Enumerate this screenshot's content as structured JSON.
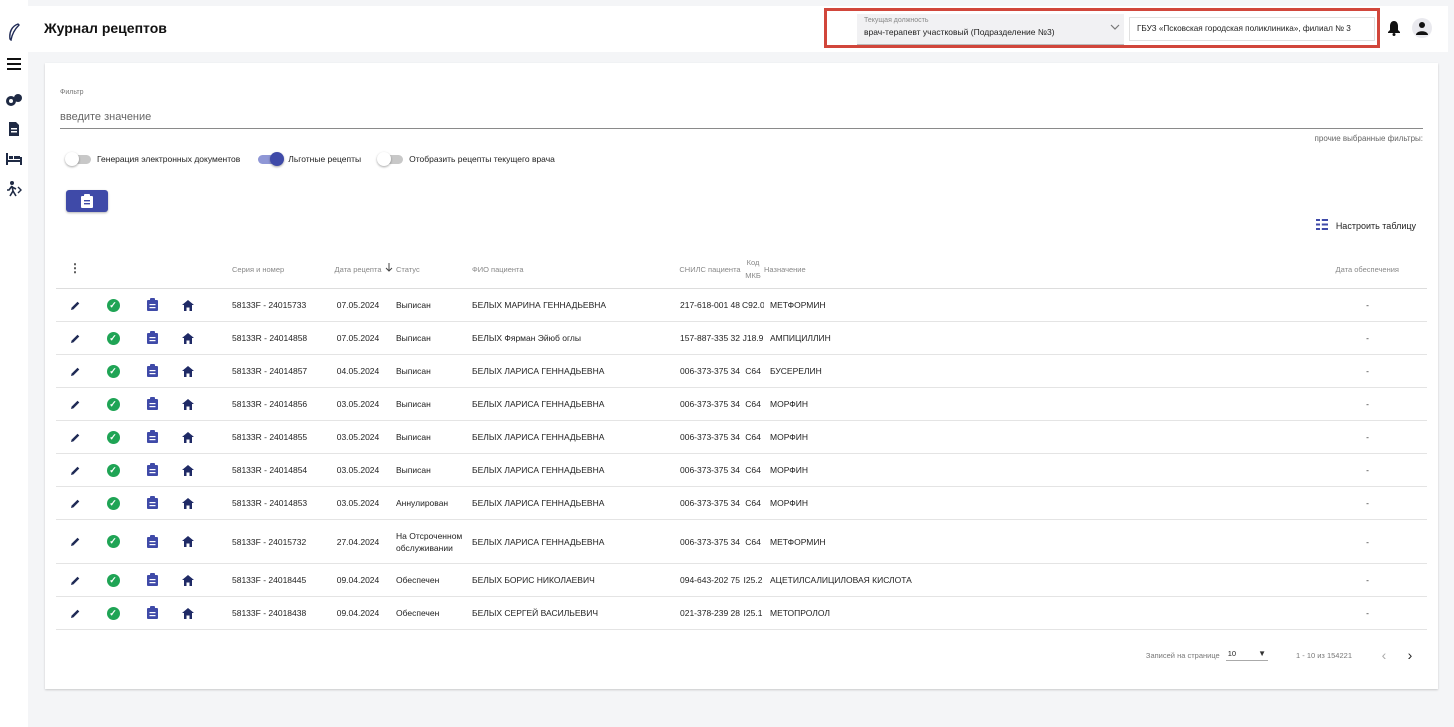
{
  "app": {
    "title": "Журнал рецептов"
  },
  "rail": {
    "icons": [
      "feather-logo-icon",
      "menu-icon",
      "pills-icon",
      "document-icon",
      "bed-icon",
      "walking-icon"
    ]
  },
  "header": {
    "position_label": "Текущая должность",
    "position_value": "врач-терапевт участковый (Подразделение №3)",
    "organization": "ГБУЗ «Псковская городская поликлиника», филиал № 3"
  },
  "filter": {
    "label": "Фильтр",
    "placeholder": "введите значение",
    "other_filters": "прочие выбранные фильтры:"
  },
  "toggles": [
    {
      "label": "Генерация электронных документов",
      "on": false
    },
    {
      "label": "Льготные рецепты",
      "on": true
    },
    {
      "label": "Отобразить рецепты текущего врача",
      "on": false
    }
  ],
  "config_table_label": "Настроить таблицу",
  "colors": {
    "primary": "#3f4aa8",
    "success": "#1fa455",
    "highlight": "#d1463b"
  },
  "table": {
    "headers": {
      "series": "Серия и номер",
      "date": "Дата рецепта",
      "status": "Статус",
      "patient": "ФИО пациента",
      "snils": "СНИЛС пациента",
      "mkb": "Код МКБ",
      "drug": "Назначение",
      "supply_date": "Дата обеспечения"
    },
    "rows": [
      {
        "series": "58133F - 24015733",
        "date": "07.05.2024",
        "status": "Выписан",
        "patient": "БЕЛЫХ МАРИНА ГЕННАДЬЕВНА",
        "snils": "217-618-001 48",
        "mkb": "C92.0",
        "drug": "МЕТФОРМИН",
        "supply": "-"
      },
      {
        "series": "58133R - 24014858",
        "date": "07.05.2024",
        "status": "Выписан",
        "patient": "БЕЛЫХ Фярман Эйюб оглы",
        "snils": "157-887-335 32",
        "mkb": "J18.9",
        "drug": "АМПИЦИЛЛИН",
        "supply": "-"
      },
      {
        "series": "58133R - 24014857",
        "date": "04.05.2024",
        "status": "Выписан",
        "patient": "БЕЛЫХ ЛАРИСА ГЕННАДЬЕВНА",
        "snils": "006-373-375 34",
        "mkb": "C64",
        "drug": "БУСЕРЕЛИН",
        "supply": "-"
      },
      {
        "series": "58133R - 24014856",
        "date": "03.05.2024",
        "status": "Выписан",
        "patient": "БЕЛЫХ ЛАРИСА ГЕННАДЬЕВНА",
        "snils": "006-373-375 34",
        "mkb": "C64",
        "drug": "МОРФИН",
        "supply": "-"
      },
      {
        "series": "58133R - 24014855",
        "date": "03.05.2024",
        "status": "Выписан",
        "patient": "БЕЛЫХ ЛАРИСА ГЕННАДЬЕВНА",
        "snils": "006-373-375 34",
        "mkb": "C64",
        "drug": "МОРФИН",
        "supply": "-"
      },
      {
        "series": "58133R - 24014854",
        "date": "03.05.2024",
        "status": "Выписан",
        "patient": "БЕЛЫХ ЛАРИСА ГЕННАДЬЕВНА",
        "snils": "006-373-375 34",
        "mkb": "C64",
        "drug": "МОРФИН",
        "supply": "-"
      },
      {
        "series": "58133R - 24014853",
        "date": "03.05.2024",
        "status": "Аннулирован",
        "patient": "БЕЛЫХ ЛАРИСА ГЕННАДЬЕВНА",
        "snils": "006-373-375 34",
        "mkb": "C64",
        "drug": "МОРФИН",
        "supply": "-"
      },
      {
        "series": "58133F - 24015732",
        "date": "27.04.2024",
        "status": "На Отсроченном обслуживании",
        "patient": "БЕЛЫХ ЛАРИСА ГЕННАДЬЕВНА",
        "snils": "006-373-375 34",
        "mkb": "C64",
        "drug": "МЕТФОРМИН",
        "supply": "-"
      },
      {
        "series": "58133F - 24018445",
        "date": "09.04.2024",
        "status": "Обеспечен",
        "patient": "БЕЛЫХ БОРИС НИКОЛАЕВИЧ",
        "snils": "094-643-202 75",
        "mkb": "I25.2",
        "drug": "АЦЕТИЛСАЛИЦИЛОВАЯ КИСЛОТА",
        "supply": "-"
      },
      {
        "series": "58133F - 24018438",
        "date": "09.04.2024",
        "status": "Обеспечен",
        "patient": "БЕЛЫХ СЕРГЕЙ ВАСИЛЬЕВИЧ",
        "snils": "021-378-239 28",
        "mkb": "I25.1",
        "drug": "МЕТОПРОЛОЛ",
        "supply": "-"
      }
    ]
  },
  "pagination": {
    "per_page_label": "Записей на странице",
    "per_page_value": "10",
    "range": "1 - 10 из 154221"
  }
}
